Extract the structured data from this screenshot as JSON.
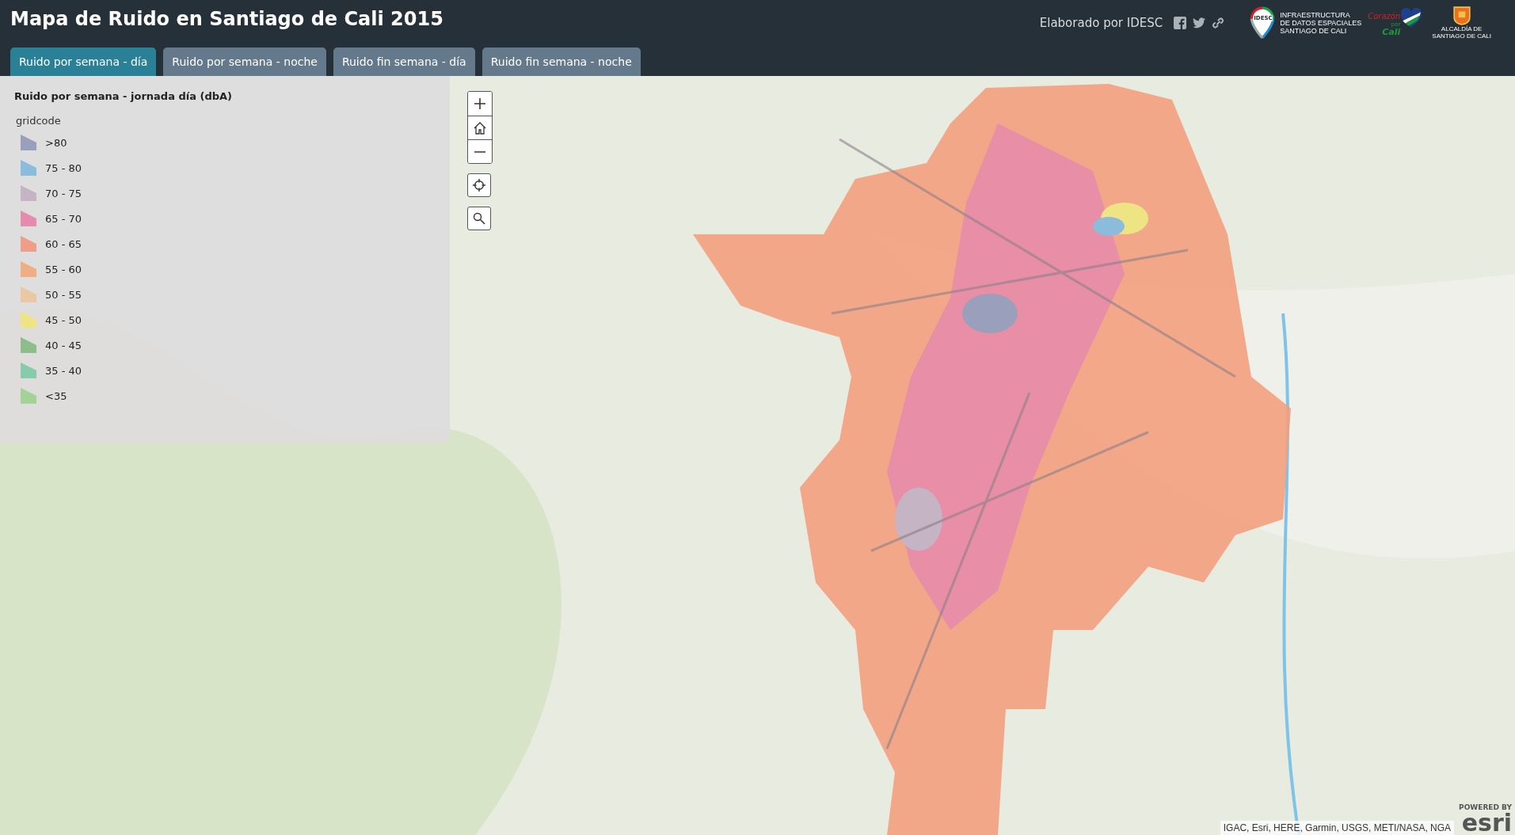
{
  "header": {
    "title": "Mapa de Ruido en Santiago de Cali 2015",
    "credit": "Elaborado por IDESC",
    "logos": {
      "idesc_mark": "IDESC",
      "idesc_name": [
        "INFRAESTRUCTURA",
        "DE DATOS ESPACIALES",
        "SANTIAGO DE CALI"
      ],
      "heart": [
        "Corazón",
        "por",
        "Cali"
      ],
      "alcaldia": [
        "ALCALDÍA DE",
        "SANTIAGO DE CALI"
      ]
    }
  },
  "tabs": [
    {
      "label": "Ruido por semana - día",
      "selected": true
    },
    {
      "label": "Ruido por semana - noche",
      "selected": false
    },
    {
      "label": "Ruido fin semana - día",
      "selected": false
    },
    {
      "label": "Ruido fin semana - noche",
      "selected": false
    }
  ],
  "legend": {
    "title": "Ruido por semana - jornada día (dbA)",
    "field": "gridcode",
    "items": [
      {
        "label": ">80",
        "color": "#9a9fbb"
      },
      {
        "label": "75 - 80",
        "color": "#8bbcdb"
      },
      {
        "label": "70 - 75",
        "color": "#c4b4c4"
      },
      {
        "label": "65 - 70",
        "color": "#e68bb0"
      },
      {
        "label": "60 - 65",
        "color": "#ef9f88"
      },
      {
        "label": "55 - 60",
        "color": "#f0ae84"
      },
      {
        "label": "50 - 55",
        "color": "#eac8a4"
      },
      {
        "label": "45 - 50",
        "color": "#efe483"
      },
      {
        "label": "40 - 45",
        "color": "#8cbd8a"
      },
      {
        "label": "35 - 40",
        "color": "#85cbac"
      },
      {
        "label": "<35",
        "color": "#a3d296"
      }
    ]
  },
  "attribution": "IGAC, Esri, HERE, Garmin, USGS, METI/NASA, NGA",
  "esri": {
    "powered": "POWERED BY",
    "brand": "esri"
  }
}
